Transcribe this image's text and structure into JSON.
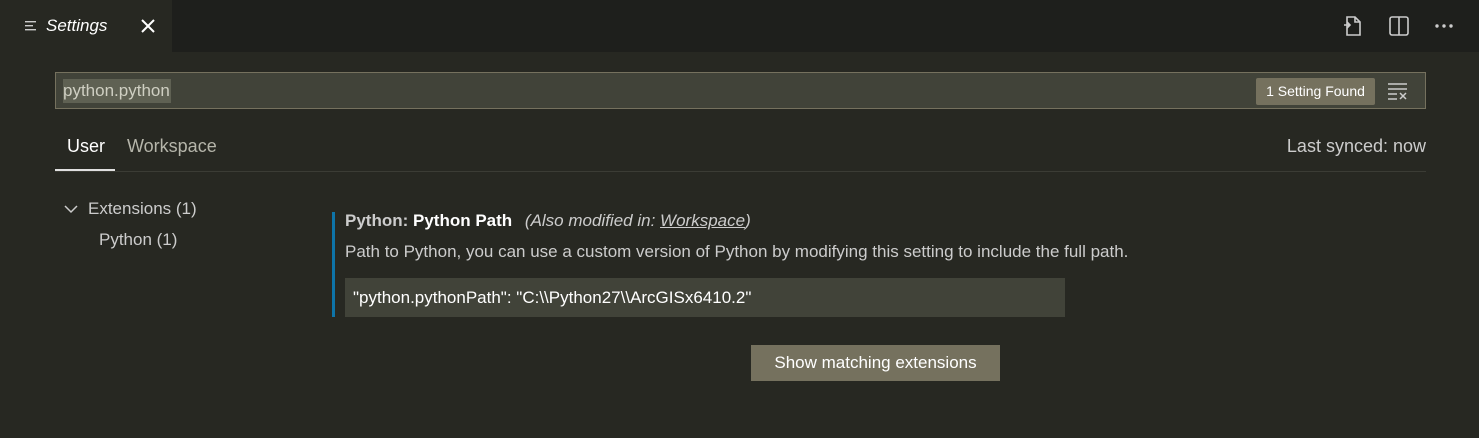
{
  "tab": {
    "title": "Settings",
    "icon": "settings-list-icon",
    "close_icon": "close-icon"
  },
  "toolbar": {
    "actions": [
      "open-settings-json-icon",
      "split-editor-icon",
      "more-actions-icon"
    ]
  },
  "search": {
    "value": "python.python",
    "results_badge": "1 Setting Found",
    "clear_icon": "clear-filter-icon"
  },
  "scope": {
    "tabs": [
      "User",
      "Workspace"
    ],
    "active": "User",
    "sync_status": "Last synced: now"
  },
  "toc": {
    "group": "Extensions (1)",
    "items": [
      "Python (1)"
    ]
  },
  "setting": {
    "category": "Python: ",
    "name": "Python Path",
    "also_modified_prefix": "(Also modified in: ",
    "also_modified_link": "Workspace",
    "also_modified_suffix": ")",
    "description": "Path to Python, you can use a custom version of Python by modifying this setting to include the full path.",
    "value": "\"python.pythonPath\": \"C:\\\\Python27\\\\ArcGISx6410.2\""
  },
  "buttons": {
    "show_extensions": "Show matching extensions"
  },
  "colors": {
    "background": "#272822",
    "tabbar": "#1e1f1c",
    "accent_bar": "#0e74a8",
    "button": "#75715e",
    "input": "#414339"
  }
}
